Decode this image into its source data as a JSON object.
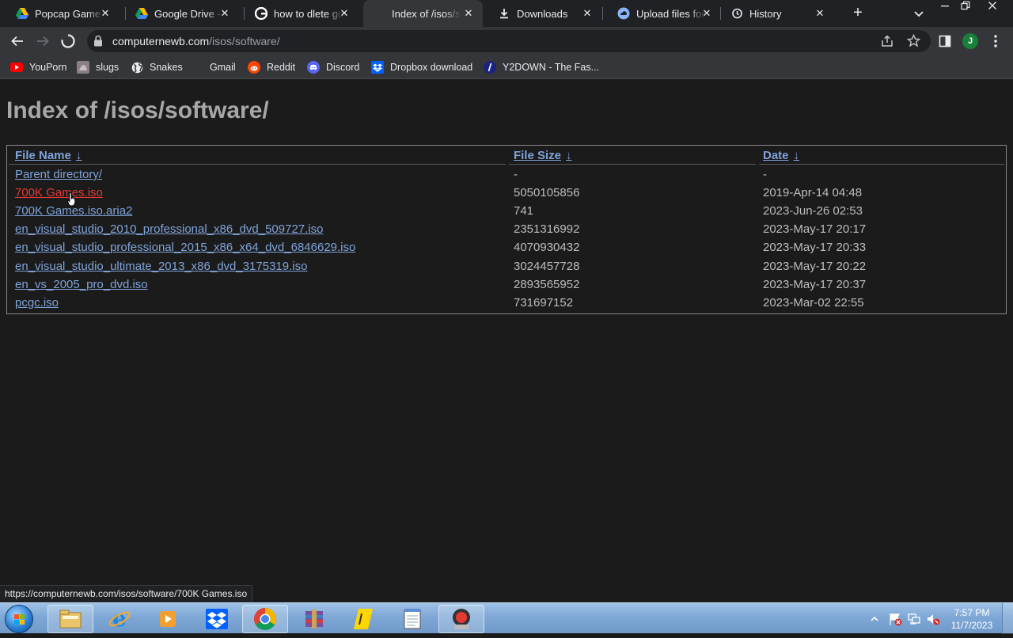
{
  "browser": {
    "tabs": [
      {
        "title": "Popcap Game C",
        "icon": "google-drive-icon",
        "active": false
      },
      {
        "title": "Google Drive - V",
        "icon": "google-drive-icon",
        "active": false
      },
      {
        "title": "how to dlete go",
        "icon": "google-icon",
        "active": false
      },
      {
        "title": "Index of /isos/sc",
        "icon": "none",
        "active": true
      },
      {
        "title": "Downloads",
        "icon": "download-icon",
        "active": false
      },
      {
        "title": "Upload files for",
        "icon": "upload-icon",
        "active": false
      },
      {
        "title": "History",
        "icon": "history-icon",
        "active": false
      }
    ],
    "omnibox": {
      "host": "computernewb.com",
      "path": "/isos/software/"
    },
    "profile_initial": "J",
    "bookmarks": [
      {
        "label": "YouPorn",
        "icon": "youtube-play-icon"
      },
      {
        "label": "slugs",
        "icon": "slug-image-icon"
      },
      {
        "label": "Snakes",
        "icon": "globe-icon"
      },
      {
        "label": "Gmail",
        "icon": "none"
      },
      {
        "label": "Reddit",
        "icon": "reddit-icon"
      },
      {
        "label": "Discord",
        "icon": "discord-icon"
      },
      {
        "label": "Dropbox download",
        "icon": "dropbox-icon"
      },
      {
        "label": "Y2DOWN - The Fas...",
        "icon": "y2down-icon"
      }
    ],
    "status_url": "https://computernewb.com/isos/software/700K Games.iso"
  },
  "page": {
    "heading": "Index of /isos/software/",
    "columns": {
      "name": "File Name",
      "size": "File Size",
      "date": "Date",
      "sort_arrow": "↓"
    },
    "rows": [
      {
        "name": "Parent directory/",
        "size": "-",
        "date": "-"
      },
      {
        "name": "700K Games.iso",
        "size": "5050105856",
        "date": "2019-Apr-14 04:48"
      },
      {
        "name": "700K Games.iso.aria2",
        "size": "741",
        "date": "2023-Jun-26 02:53"
      },
      {
        "name": "en_visual_studio_2010_professional_x86_dvd_509727.iso",
        "size": "2351316992",
        "date": "2023-May-17 20:17"
      },
      {
        "name": "en_visual_studio_professional_2015_x86_x64_dvd_6846629.iso",
        "size": "4070930432",
        "date": "2023-May-17 20:33"
      },
      {
        "name": "en_visual_studio_ultimate_2013_x86_dvd_3175319.iso",
        "size": "3024457728",
        "date": "2023-May-17 20:22"
      },
      {
        "name": "en_vs_2005_pro_dvd.iso",
        "size": "2893565952",
        "date": "2023-May-17 20:37"
      },
      {
        "name": "pcgc.iso",
        "size": "731697152",
        "date": "2023-Mar-02 22:55"
      }
    ]
  },
  "taskbar": {
    "apps": [
      "file-explorer-icon",
      "internet-explorer-icon",
      "media-player-icon",
      "dropbox-icon",
      "chrome-icon",
      "winrar-icon",
      "sticky-note-icon",
      "notepad-icon",
      "record-app-icon"
    ],
    "time": "7:57 PM",
    "date": "11/7/2023"
  },
  "colors": {
    "link": "#7fa3d9",
    "link_hover": "#e53935",
    "page_bg": "#1b1b1b",
    "chrome_dark": "#202124",
    "chrome_toolbar": "#35363a"
  }
}
